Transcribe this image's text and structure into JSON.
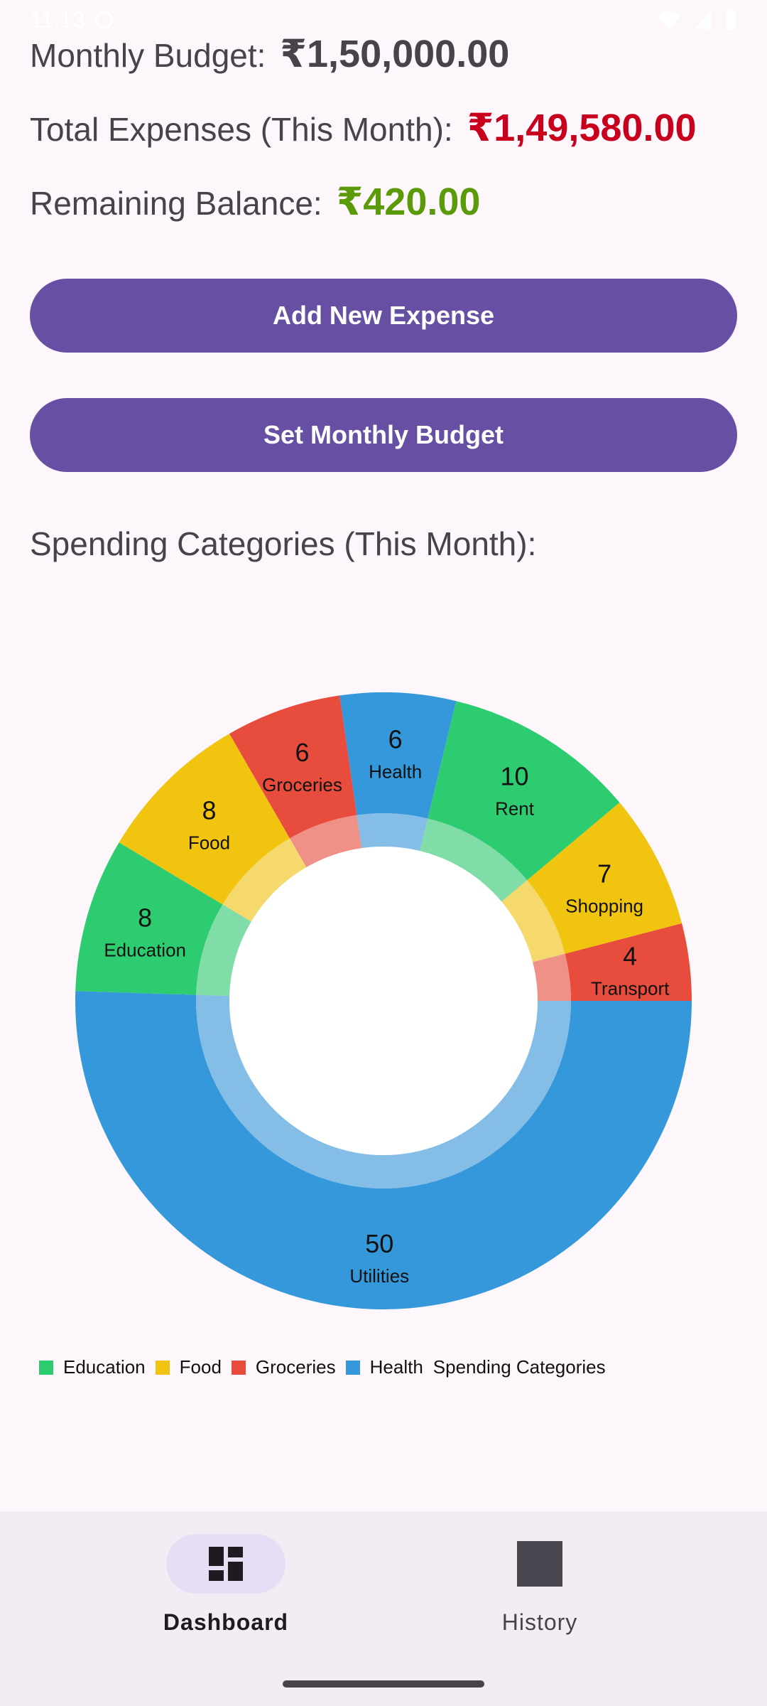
{
  "status_bar": {
    "time": "11:13"
  },
  "summary": {
    "budget_label": "Monthly Budget:",
    "budget_value": "₹1,50,000.00",
    "expenses_label": "Total Expenses (This Month):",
    "expenses_value": "₹1,49,580.00",
    "balance_label": "Remaining Balance:",
    "balance_value": "₹420.00",
    "colors": {
      "budget": "#46434a",
      "expenses": "#c8001e",
      "balance": "#5b9a09"
    }
  },
  "buttons": {
    "add_expense": "Add New Expense",
    "set_budget": "Set Monthly Budget"
  },
  "section": {
    "title": "Spending Categories (This Month):"
  },
  "chart_data": {
    "type": "pie",
    "style": "donut",
    "slices": [
      {
        "label": "Utilities",
        "value": 50,
        "color": "#3498db"
      },
      {
        "label": "Education",
        "value": 8,
        "color": "#2ecc71"
      },
      {
        "label": "Food",
        "value": 8,
        "color": "#f1c40f"
      },
      {
        "label": "Groceries",
        "value": 6,
        "color": "#e74c3c"
      },
      {
        "label": "Health",
        "value": 6,
        "color": "#3498db"
      },
      {
        "label": "Rent",
        "value": 10,
        "color": "#2ecc71"
      },
      {
        "label": "Shopping",
        "value": 7,
        "color": "#f1c40f"
      },
      {
        "label": "Transport",
        "value": 4,
        "color": "#e74c3c"
      }
    ],
    "legend": {
      "entries": [
        {
          "label": "Education",
          "color": "#2ecc71"
        },
        {
          "label": "Food",
          "color": "#f1c40f"
        },
        {
          "label": "Groceries",
          "color": "#e74c3c"
        },
        {
          "label": "Health",
          "color": "#3498db"
        }
      ],
      "description": "Spending Categories",
      "placement": "bottom-left"
    }
  },
  "nav": {
    "items": [
      {
        "label": "Dashboard",
        "icon": "dashboard-icon",
        "active": true
      },
      {
        "label": "History",
        "icon": "history-icon",
        "active": false
      }
    ]
  }
}
